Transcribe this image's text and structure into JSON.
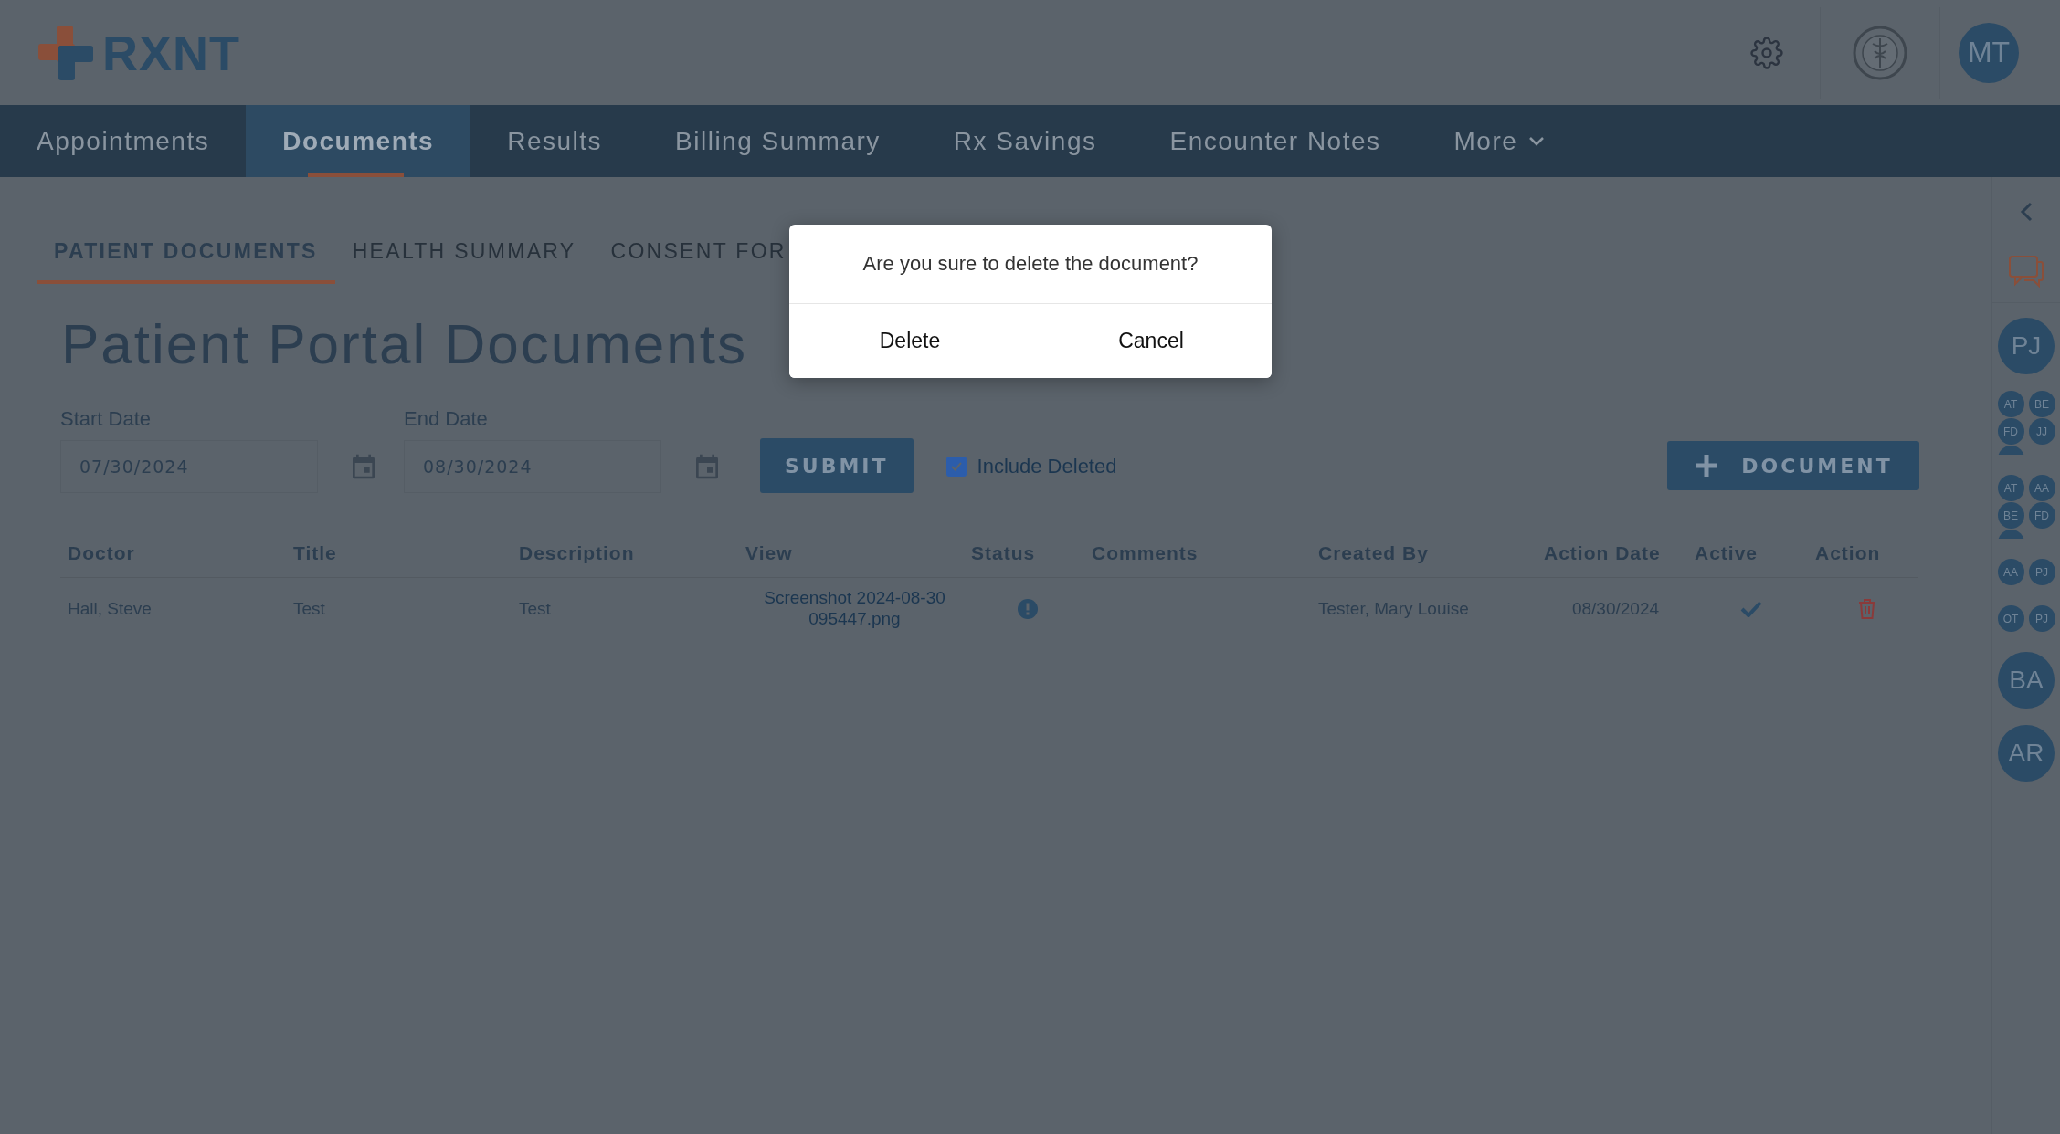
{
  "header": {
    "logo": "RXNT",
    "user_avatar": "MT"
  },
  "nav": [
    {
      "label": "Appointments",
      "selected": false
    },
    {
      "label": "Documents",
      "selected": true
    },
    {
      "label": "Results",
      "selected": false
    },
    {
      "label": "Billing Summary",
      "selected": false
    },
    {
      "label": "Rx Savings",
      "selected": false
    },
    {
      "label": "Encounter Notes",
      "selected": false
    },
    {
      "label": "More",
      "selected": false,
      "kind": "dropdown"
    }
  ],
  "subtabs": [
    {
      "label": "PATIENT DOCUMENTS",
      "selected": true
    },
    {
      "label": "HEALTH SUMMARY",
      "selected": false
    },
    {
      "label": "CONSENT FOR",
      "selected": false
    }
  ],
  "page_title": "Patient Portal Documents",
  "filters": {
    "start_date": {
      "label": "Start Date",
      "value": "07/30/2024"
    },
    "end_date": {
      "label": "End Date",
      "value": "08/30/2024"
    },
    "submit": "SUBMIT",
    "include_deleted": {
      "label": "Include Deleted",
      "checked": true
    },
    "add_document": "DOCUMENT"
  },
  "table": {
    "columns": [
      "Doctor",
      "Title",
      "Description",
      "View",
      "Status",
      "Comments",
      "Created By",
      "Action Date",
      "Active",
      "Action"
    ],
    "rows": [
      {
        "doctor": "Hall, Steve",
        "title": "Test",
        "description": "Test",
        "view": "Screenshot 2024-08-30 095447.png",
        "created_by": "Tester, Mary Louise",
        "action_date": "08/30/2024",
        "active": true
      }
    ]
  },
  "sidebar": {
    "groups": [
      {
        "kind": "large",
        "avatars": [
          "PJ"
        ]
      },
      {
        "kind": "small",
        "avatars": [
          "AT",
          "BE",
          "FD",
          "JJ"
        ],
        "more": true
      },
      {
        "kind": "small",
        "avatars": [
          "AT",
          "AA",
          "BE",
          "FD"
        ],
        "more": true
      },
      {
        "kind": "small",
        "avatars": [
          "AA",
          "PJ"
        ],
        "more": false
      },
      {
        "kind": "small",
        "avatars": [
          "OT",
          "PJ"
        ],
        "more": false
      },
      {
        "kind": "large",
        "avatars": [
          "BA"
        ]
      },
      {
        "kind": "large",
        "avatars": [
          "AR"
        ]
      }
    ]
  },
  "modal": {
    "message": "Are you sure to delete the document?",
    "buttons": [
      "Delete",
      "Cancel"
    ]
  }
}
